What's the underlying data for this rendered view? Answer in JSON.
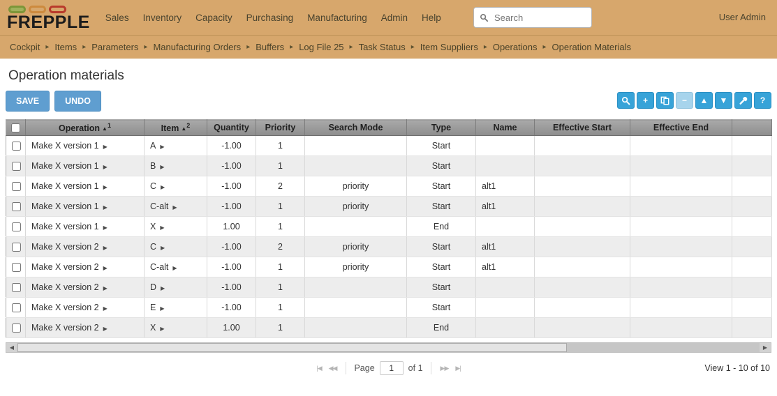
{
  "colors": {
    "topbar": "#d7a76c",
    "accent_blue": "#37a3d8",
    "button_blue": "#5f9ed0"
  },
  "topbar": {
    "logo_text": "FREPPLE",
    "nav_items": [
      "Sales",
      "Inventory",
      "Capacity",
      "Purchasing",
      "Manufacturing",
      "Admin",
      "Help"
    ],
    "search_placeholder": "Search",
    "user_label": "User Admin"
  },
  "breadcrumb_separator": "▸",
  "breadcrumbs": [
    "Cockpit",
    "Items",
    "Parameters",
    "Manufacturing Orders",
    "Buffers",
    "Log File 25",
    "Task Status",
    "Item Suppliers",
    "Operations",
    "Operation Materials"
  ],
  "page_title": "Operation materials",
  "actions": {
    "save_label": "SAVE",
    "undo_label": "UNDO"
  },
  "grid_toolbar": [
    {
      "name": "search",
      "glyph": "",
      "svg": "search"
    },
    {
      "name": "add",
      "glyph": "+"
    },
    {
      "name": "copy",
      "glyph": "",
      "svg": "copy"
    },
    {
      "name": "remove",
      "glyph": "−",
      "disabled": true
    },
    {
      "name": "move-up",
      "glyph": "▲"
    },
    {
      "name": "move-down",
      "glyph": "▼"
    },
    {
      "name": "customize",
      "glyph": "",
      "svg": "wrench"
    },
    {
      "name": "help",
      "glyph": "?"
    }
  ],
  "table": {
    "drill_glyph": "▶",
    "columns": [
      {
        "key": "select",
        "label": "",
        "checkbox": true
      },
      {
        "key": "operation",
        "label": "Operation",
        "sort_icon": "▲",
        "sort_order": "1",
        "drill": true
      },
      {
        "key": "item",
        "label": "Item",
        "sort_icon": "▲",
        "sort_order": "2",
        "drill": true
      },
      {
        "key": "quantity",
        "label": "Quantity"
      },
      {
        "key": "priority",
        "label": "Priority"
      },
      {
        "key": "search_mode",
        "label": "Search Mode"
      },
      {
        "key": "type",
        "label": "Type"
      },
      {
        "key": "name",
        "label": "Name"
      },
      {
        "key": "effective_start",
        "label": "Effective Start"
      },
      {
        "key": "effective_end",
        "label": "Effective End"
      },
      {
        "key": "extra",
        "label": ""
      }
    ],
    "rows": [
      {
        "operation": "Make X version 1",
        "item": "A",
        "quantity": "-1.00",
        "priority": "1",
        "search_mode": "",
        "type": "Start",
        "name": "",
        "effective_start": "",
        "effective_end": ""
      },
      {
        "operation": "Make X version 1",
        "item": "B",
        "quantity": "-1.00",
        "priority": "1",
        "search_mode": "",
        "type": "Start",
        "name": "",
        "effective_start": "",
        "effective_end": ""
      },
      {
        "operation": "Make X version 1",
        "item": "C",
        "quantity": "-1.00",
        "priority": "2",
        "search_mode": "priority",
        "type": "Start",
        "name": "alt1",
        "effective_start": "",
        "effective_end": ""
      },
      {
        "operation": "Make X version 1",
        "item": "C-alt",
        "quantity": "-1.00",
        "priority": "1",
        "search_mode": "priority",
        "type": "Start",
        "name": "alt1",
        "effective_start": "",
        "effective_end": ""
      },
      {
        "operation": "Make X version 1",
        "item": "X",
        "quantity": "1.00",
        "priority": "1",
        "search_mode": "",
        "type": "End",
        "name": "",
        "effective_start": "",
        "effective_end": ""
      },
      {
        "operation": "Make X version 2",
        "item": "C",
        "quantity": "-1.00",
        "priority": "2",
        "search_mode": "priority",
        "type": "Start",
        "name": "alt1",
        "effective_start": "",
        "effective_end": ""
      },
      {
        "operation": "Make X version 2",
        "item": "C-alt",
        "quantity": "-1.00",
        "priority": "1",
        "search_mode": "priority",
        "type": "Start",
        "name": "alt1",
        "effective_start": "",
        "effective_end": ""
      },
      {
        "operation": "Make X version 2",
        "item": "D",
        "quantity": "-1.00",
        "priority": "1",
        "search_mode": "",
        "type": "Start",
        "name": "",
        "effective_start": "",
        "effective_end": ""
      },
      {
        "operation": "Make X version 2",
        "item": "E",
        "quantity": "-1.00",
        "priority": "1",
        "search_mode": "",
        "type": "Start",
        "name": "",
        "effective_start": "",
        "effective_end": ""
      },
      {
        "operation": "Make X version 2",
        "item": "X",
        "quantity": "1.00",
        "priority": "1",
        "search_mode": "",
        "type": "End",
        "name": "",
        "effective_start": "",
        "effective_end": ""
      }
    ]
  },
  "scrollbar": {
    "left_glyph": "◀",
    "right_glyph": "▶",
    "thumb_percent": 74
  },
  "pager": {
    "first_glyph": "|◀",
    "prev_glyph": "◀◀",
    "next_glyph": "▶▶",
    "last_glyph": "▶|",
    "page_label": "Page",
    "page_value": "1",
    "of_label": "of 1",
    "view_label": "View 1 - 10 of 10"
  }
}
